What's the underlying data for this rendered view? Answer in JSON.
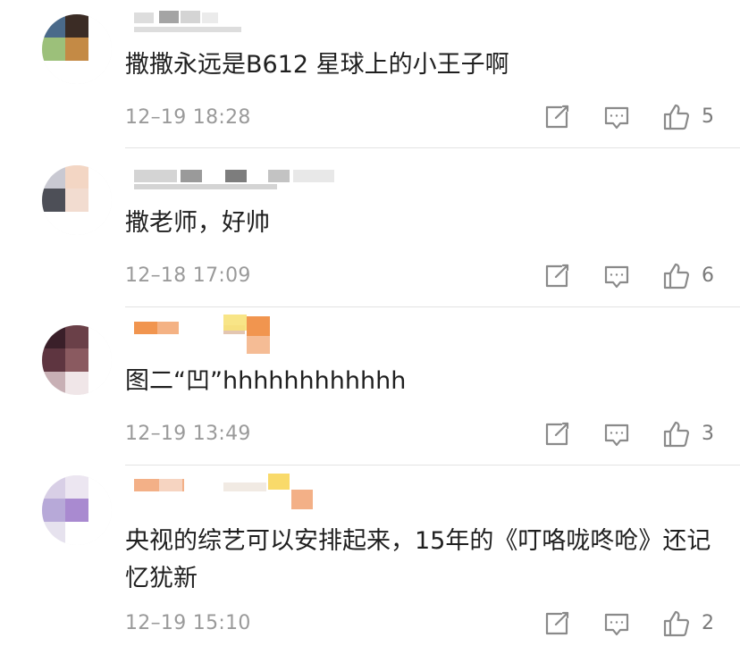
{
  "comments": [
    {
      "text": "撒撒永远是B612 星球上的小王子啊",
      "time": "12–19 18:28",
      "likes": "5",
      "avatar_colors": [
        "#4a6a8a",
        "#3b2c25",
        "#ffffff",
        "#9cc07a",
        "#c48a45",
        "#ffffff",
        "#ffffff",
        "#ffffff",
        "#ffffff"
      ],
      "nick_colors": [
        "#d9d9d9",
        "#9a9a9a",
        "#cfcfcf",
        "#e9e9e9"
      ]
    },
    {
      "text": "撒老师，好帅",
      "time": "12–18 17:09",
      "likes": "6",
      "avatar_colors": [
        "#c9c9d2",
        "#f3d6c4",
        "#ffffff",
        "#4d4f57",
        "#f2dcd0",
        "#ffffff",
        "#ffffff",
        "#ffffff",
        "#ffffff"
      ],
      "nick_colors": [
        "#cfcfcf",
        "#8f8f8f",
        "#6f6f6f",
        "#bdbdbd",
        "#e6e6e6"
      ]
    },
    {
      "text": "图二“凹”hhhhhhhhhhhh",
      "time": "12–19 13:49",
      "likes": "3",
      "avatar_colors": [
        "#3a1f29",
        "#6a4048",
        "#ffffff",
        "#5e3540",
        "#8a5a60",
        "#ffffff",
        "#c8b0b5",
        "#f0e6e8",
        "#ffffff"
      ],
      "nick_colors": [
        "#f08a3c",
        "#f4b58a",
        "#e0c0a8",
        "#f7e27a"
      ]
    },
    {
      "text": "央视的综艺可以安排起来，15年的《叮咯咙咚呛》还记忆犹新",
      "time": "12–19 15:10",
      "likes": "2",
      "avatar_colors": [
        "#d8cfe6",
        "#ece6f1",
        "#ffffff",
        "#b7a9d8",
        "#a98ad0",
        "#ffffff",
        "#e6e2ee",
        "#ffffff",
        "#ffffff"
      ],
      "nick_colors": [
        "#f2a77a",
        "#f6d8c8",
        "#f0e8e0",
        "#f8d65a"
      ]
    }
  ],
  "icons": {
    "share": "share-icon",
    "comment": "comment-icon",
    "like": "thumbs-up-icon"
  }
}
